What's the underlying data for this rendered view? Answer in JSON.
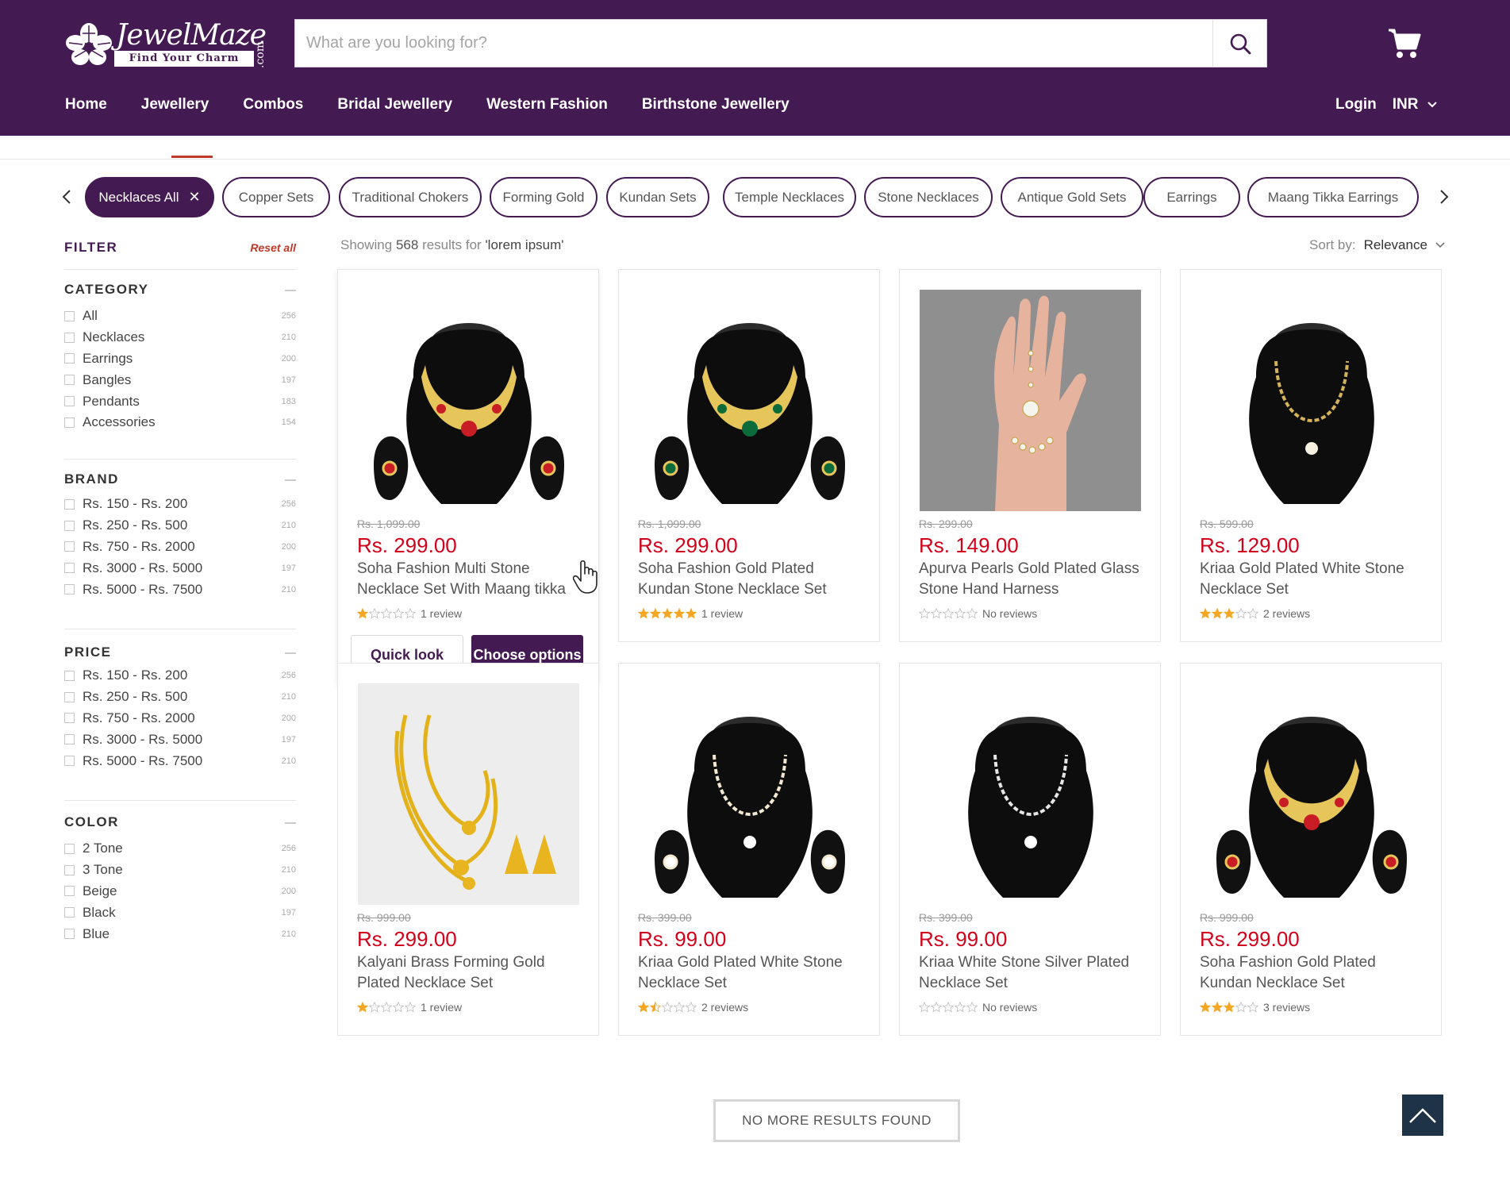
{
  "brand": {
    "name": "JewelMaze",
    "tagline": "Find Your Charm",
    "suffix": ".com"
  },
  "search": {
    "placeholder": "What are you looking for?"
  },
  "nav": {
    "items": [
      "Home",
      "Jewellery",
      "Combos",
      "Bridal Jewellery",
      "Western Fashion",
      "Birthstone Jewellery"
    ],
    "login": "Login",
    "currency": "INR"
  },
  "chips": [
    "Necklaces All",
    "Copper Sets",
    "Traditional Chokers",
    "Forming Gold",
    "Kundan Sets",
    "Temple Necklaces",
    "Stone Necklaces",
    "Antique Gold Sets",
    "Earrings",
    "Maang Tikka Earrings"
  ],
  "filter": {
    "title": "FILTER",
    "reset": "Reset all",
    "groups": [
      {
        "title": "CATEGORY",
        "options": [
          [
            "All",
            "256"
          ],
          [
            "Necklaces",
            "210"
          ],
          [
            "Earrings",
            "200"
          ],
          [
            "Bangles",
            "197"
          ],
          [
            "Pendants",
            "183"
          ],
          [
            "Accessories",
            "154"
          ]
        ]
      },
      {
        "title": "BRAND",
        "options": [
          [
            "Rs. 150 - Rs. 200",
            "256"
          ],
          [
            "Rs. 250 - Rs. 500",
            "210"
          ],
          [
            "Rs. 750 - Rs. 2000",
            "200"
          ],
          [
            "Rs. 3000 - Rs. 5000",
            "197"
          ],
          [
            "Rs. 5000 - Rs. 7500",
            "210"
          ]
        ]
      },
      {
        "title": "PRICE",
        "options": [
          [
            "Rs. 150 - Rs. 200",
            "256"
          ],
          [
            "Rs. 250 - Rs. 500",
            "210"
          ],
          [
            "Rs. 750 - Rs. 2000",
            "200"
          ],
          [
            "Rs. 3000 - Rs. 5000",
            "197"
          ],
          [
            "Rs. 5000 - Rs. 7500",
            "210"
          ]
        ]
      },
      {
        "title": "COLOR",
        "options": [
          [
            "2 Tone",
            "256"
          ],
          [
            "3 Tone",
            "210"
          ],
          [
            "Beige",
            "200"
          ],
          [
            "Black",
            "197"
          ],
          [
            "Blue",
            "210"
          ]
        ]
      }
    ]
  },
  "results": {
    "prefix": "Showing",
    "count": "568",
    "mid": "results for",
    "query": "'lorem ipsum'"
  },
  "sort": {
    "label": "Sort by:",
    "value": "Relevance"
  },
  "products": [
    {
      "old": "Rs. 1,099.00",
      "price": "Rs. 299.00",
      "name": "Soha Fashion Multi Stone Necklace Set With Maang tikka",
      "stars": 1,
      "reviews": "1 review",
      "img": "necklace-red"
    },
    {
      "old": "Rs. 1,099.00",
      "price": "Rs. 299.00",
      "name": "Soha Fashion Gold Plated Kundan Stone Necklace Set",
      "stars": 5,
      "reviews": "1 review",
      "img": "necklace-green"
    },
    {
      "old": "Rs. 299.00",
      "price": "Rs. 149.00",
      "name": "Apurva Pearls Gold Plated Glass Stone Hand Harness",
      "stars": 0,
      "reviews": "No reviews",
      "img": "hand-harness"
    },
    {
      "old": "Rs. 599.00",
      "price": "Rs. 129.00",
      "name": "Kriaa Gold Plated White Stone Necklace Set",
      "stars": 3,
      "reviews": "2 reviews",
      "img": "necklace-thin"
    },
    {
      "old": "Rs. 999.00",
      "price": "Rs. 299.00",
      "name": "Kalyani Brass Forming Gold Plated Necklace Set",
      "stars": 1,
      "reviews": "1 review",
      "img": "gold-forming"
    },
    {
      "old": "Rs. 399.00",
      "price": "Rs. 99.00",
      "name": "Kriaa Gold Plated White Stone Necklace Set",
      "stars": 1.5,
      "reviews": "2 reviews",
      "img": "necklace-pearl"
    },
    {
      "old": "Rs. 399.00",
      "price": "Rs. 99.00",
      "name": "Kriaa White Stone Silver Plated Necklace Set",
      "stars": 0,
      "reviews": "No reviews",
      "img": "necklace-silver"
    },
    {
      "old": "Rs. 999.00",
      "price": "Rs. 299.00",
      "name": "Soha Fashion Gold Plated Kundan Necklace Set",
      "stars": 3,
      "reviews": "3 reviews",
      "img": "necklace-kundan"
    }
  ],
  "card_actions": {
    "quick_look": "Quick look",
    "choose_options": "Choose options"
  },
  "footer": {
    "no_more": "NO MORE RESULTS  FOUND"
  },
  "colors": {
    "brand": "#441a52",
    "price": "#d0021b",
    "star": "#f5a623",
    "reset": "#c0392b"
  },
  "icons": [
    "search-icon",
    "cart-icon",
    "chevron-down-icon",
    "chevron-left-icon",
    "chevron-right-icon",
    "close-icon",
    "star-icon",
    "arrow-up-icon",
    "hand-cursor-icon"
  ]
}
